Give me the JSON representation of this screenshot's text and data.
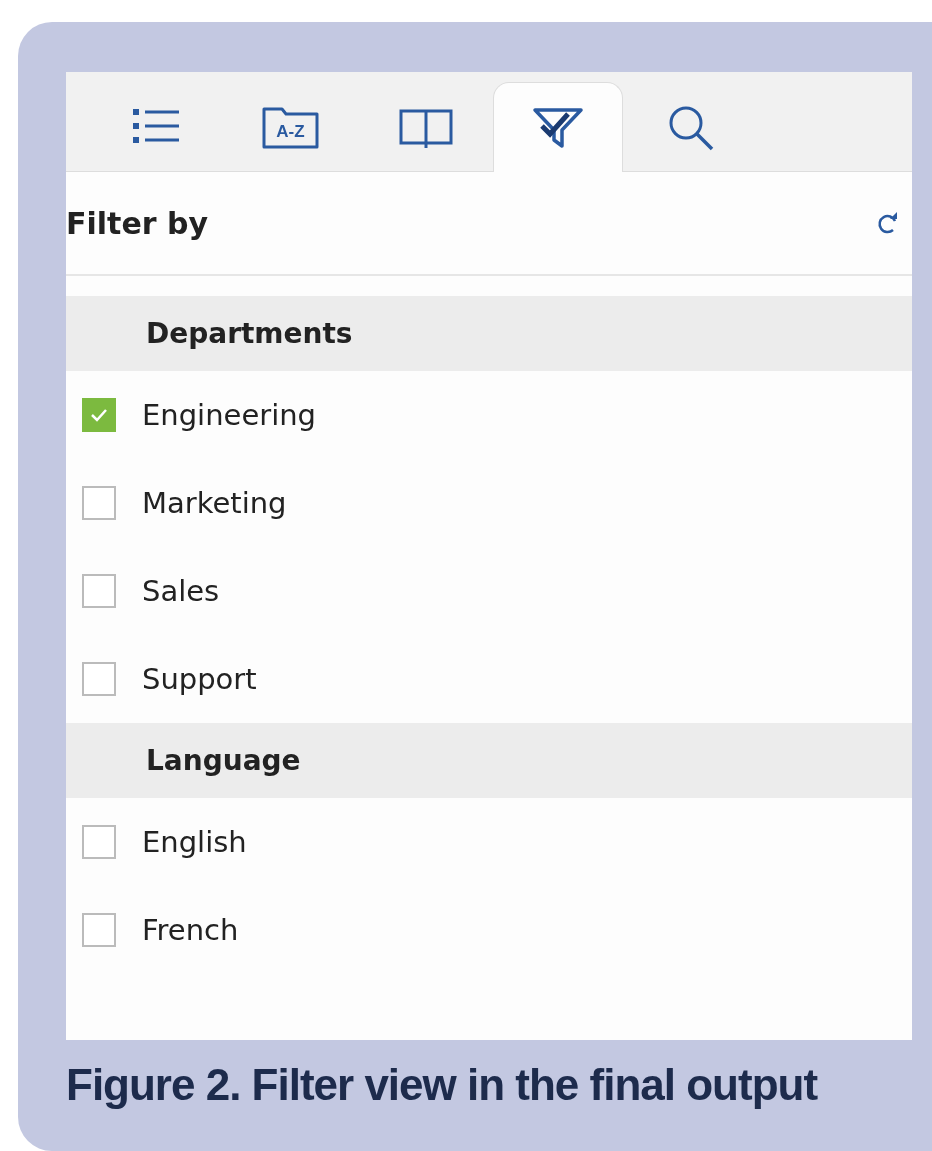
{
  "tabs": [
    {
      "kind": "list",
      "selected": false
    },
    {
      "kind": "az-folder",
      "text": "A-Z",
      "selected": false
    },
    {
      "kind": "book",
      "selected": false
    },
    {
      "kind": "filter",
      "selected": true
    },
    {
      "kind": "search",
      "selected": false
    }
  ],
  "header": {
    "title": "Filter by"
  },
  "groups": [
    {
      "title": "Departments",
      "items": [
        {
          "label": "Engineering",
          "checked": true
        },
        {
          "label": "Marketing",
          "checked": false
        },
        {
          "label": "Sales",
          "checked": false
        },
        {
          "label": "Support",
          "checked": false
        }
      ]
    },
    {
      "title": "Language",
      "items": [
        {
          "label": "English",
          "checked": false
        },
        {
          "label": "French",
          "checked": false
        }
      ]
    }
  ],
  "caption": "Figure 2. Filter view in the final output"
}
